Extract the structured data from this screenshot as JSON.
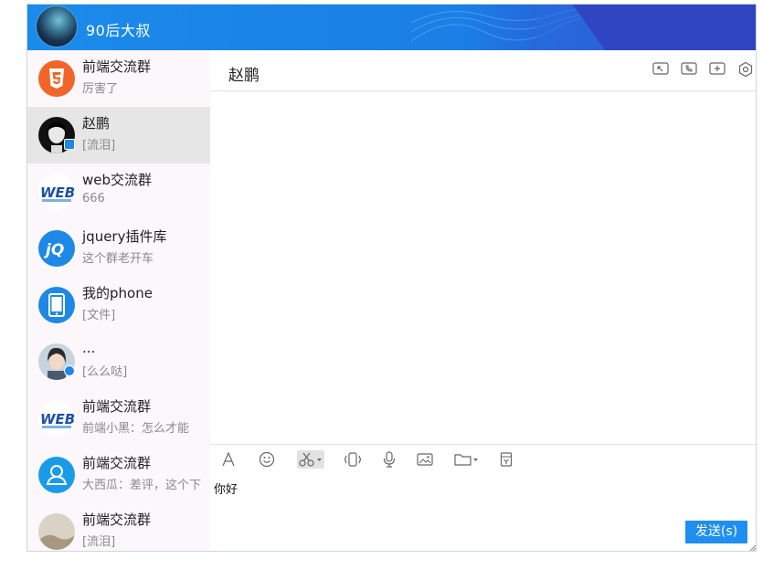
{
  "user": {
    "name": "90后大叔"
  },
  "contacts": [
    {
      "name": "前端交流群",
      "msg": "厉害了",
      "avatar": "html5-icon"
    },
    {
      "name": "赵鹏",
      "msg": "[流泪]",
      "avatar": "user-photo-bw"
    },
    {
      "name": "web交流群",
      "msg": "666",
      "avatar": "web-logo"
    },
    {
      "name": "jquery插件库",
      "msg": "这个群老开车",
      "avatar": "jquery-logo"
    },
    {
      "name": "我的phone",
      "msg": "[文件]",
      "avatar": "phone-icon"
    },
    {
      "name": "...",
      "msg": "[么么哒]",
      "avatar": "girl-photo"
    },
    {
      "name": "前端交流群",
      "msg": "前端小黑：怎么才能",
      "avatar": "web-logo"
    },
    {
      "name": "前端交流群",
      "msg": "大西瓜：差评，这个下",
      "avatar": "user-icon"
    },
    {
      "name": "前端交流群",
      "msg": "[流泪]",
      "avatar": "photo"
    }
  ],
  "chat": {
    "title": "赵鹏",
    "input_text": "你好",
    "send_label": "发送(s)"
  },
  "colors": {
    "accent": "#1e8ff0",
    "titlebar": "#1a7fe6"
  }
}
